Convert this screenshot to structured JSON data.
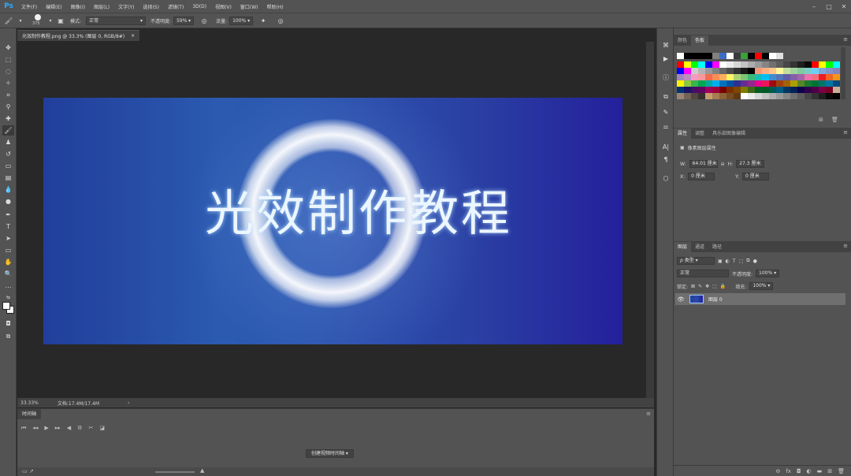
{
  "app": {
    "logo": "Ps"
  },
  "menu": [
    "文件(F)",
    "编辑(E)",
    "图像(I)",
    "图层(L)",
    "文字(Y)",
    "选择(S)",
    "滤镜(T)",
    "3D(D)",
    "视图(V)",
    "窗口(W)",
    "帮助(H)"
  ],
  "options": {
    "brush_size": "375",
    "mode_label": "模式:",
    "mode_value": "正常",
    "opacity_label": "不透明度:",
    "opacity_value": "59%",
    "flow_label": "流量:",
    "flow_value": "100%"
  },
  "document": {
    "tab_title": "光效制作教程.png @ 33.3% (图层 0, RGB/8#)",
    "close": "×",
    "canvas_text": "光效制作教程",
    "zoom": "33.33%",
    "doc_info": "文档:17.4M/17.4M",
    "arrow": "›"
  },
  "timeline": {
    "tab": "时间轴",
    "create_button": "创建视频时间轴"
  },
  "panels": {
    "swatch_tabs": [
      "颜色",
      "色板"
    ],
    "swatch_active": 1,
    "props_tabs": [
      "属性",
      "调整",
      "具乐部图像编辑"
    ],
    "props_active": 0,
    "props_title": "像素图层属性",
    "w_label": "W:",
    "w_value": "64.01 厘米",
    "h_label": "H:",
    "h_value": "27.3 厘米",
    "x_label": "X:",
    "x_value": "0 厘米",
    "y_label": "Y:",
    "y_value": "0 厘米",
    "layers_tabs": [
      "图层",
      "通道",
      "路径"
    ],
    "layers_active": 0,
    "kind_label": "ρ 类型",
    "blend_mode": "正常",
    "opacity_label": "不透明度:",
    "opacity_value": "100%",
    "lock_label": "锁定:",
    "fill_label": "填充:",
    "fill_value": "100%",
    "layer_name": "图层 0"
  },
  "swatches": {
    "row0": [
      "#ffffff",
      "#000000",
      "#000000",
      "#000000",
      "#000000",
      "#808080",
      "#3c6cc4",
      "#ffffff",
      "#3a3a3a",
      "#3aa03a",
      "#000000",
      "#ff0000",
      "#000000",
      "#ffffff",
      "#e0e0e0"
    ],
    "rows": [
      [
        "#ff0000",
        "#ffff00",
        "#00ff00",
        "#00ffff",
        "#0000ff",
        "#ff00ff",
        "#ffffff",
        "#ebebeb",
        "#d6d6d6",
        "#c2c2c2",
        "#adadad",
        "#999999",
        "#858585",
        "#707070",
        "#5c5c5c",
        "#474747",
        "#333333",
        "#1f1f1f",
        "#0a0a0a",
        "#ff0000",
        "#ffff00",
        "#00ff00",
        "#00ffff"
      ],
      [
        "#0000ff",
        "#ff00ff",
        "#cccccc",
        "#b3b3b3",
        "#999999",
        "#808080",
        "#666666",
        "#4d4d4d",
        "#333333",
        "#1a1a1a",
        "#000000",
        "#f7977a",
        "#f9ad81",
        "#fdc68a",
        "#fff79a",
        "#c4df9b",
        "#a2d39c",
        "#82ca9d",
        "#7bcdc8",
        "#6ecff6",
        "#7ea7d8",
        "#8493ca",
        "#8882be"
      ],
      [
        "#a187be",
        "#bc8dbf",
        "#f49ac2",
        "#f6989d",
        "#f26c4f",
        "#f68e55",
        "#fbaf5c",
        "#fff467",
        "#acd372",
        "#7cc576",
        "#3bb878",
        "#1abbb4",
        "#00bff3",
        "#438ccb",
        "#5574b9",
        "#605ca8",
        "#855fa8",
        "#a763a8",
        "#f06ea9",
        "#f26d7d",
        "#ed1c24",
        "#f26522",
        "#f7941d"
      ],
      [
        "#fff200",
        "#8dc73f",
        "#39b54a",
        "#00a651",
        "#00a99d",
        "#00aeef",
        "#0072bc",
        "#0054a6",
        "#2e3192",
        "#662d91",
        "#92278f",
        "#ec008c",
        "#ed145b",
        "#9e0b0f",
        "#a0410d",
        "#a36209",
        "#aba000",
        "#598527",
        "#197b30",
        "#007236",
        "#00746b",
        "#0076a3",
        "#004b80"
      ],
      [
        "#003471",
        "#1b1464",
        "#440e62",
        "#630460",
        "#9e005d",
        "#9e0039",
        "#790000",
        "#7b2e00",
        "#7d4900",
        "#827b00",
        "#406618",
        "#005e20",
        "#005826",
        "#005952",
        "#005b7f",
        "#003663",
        "#002157",
        "#0d004c",
        "#32004b",
        "#4b0049",
        "#7b0046",
        "#7a0026",
        "#c7b299"
      ],
      [
        "#998675",
        "#736357",
        "#534741",
        "#37302d",
        "#c69c6d",
        "#a67c52",
        "#8c6239",
        "#754c24",
        "#603913",
        "#ffffff",
        "#ebebeb",
        "#d6d6d6",
        "#c2c2c2",
        "#adadad",
        "#999999",
        "#858585",
        "#707070",
        "#5c5c5c",
        "#474747",
        "#333333",
        "#1f1f1f",
        "#0a0a0a",
        "#000000"
      ]
    ]
  }
}
